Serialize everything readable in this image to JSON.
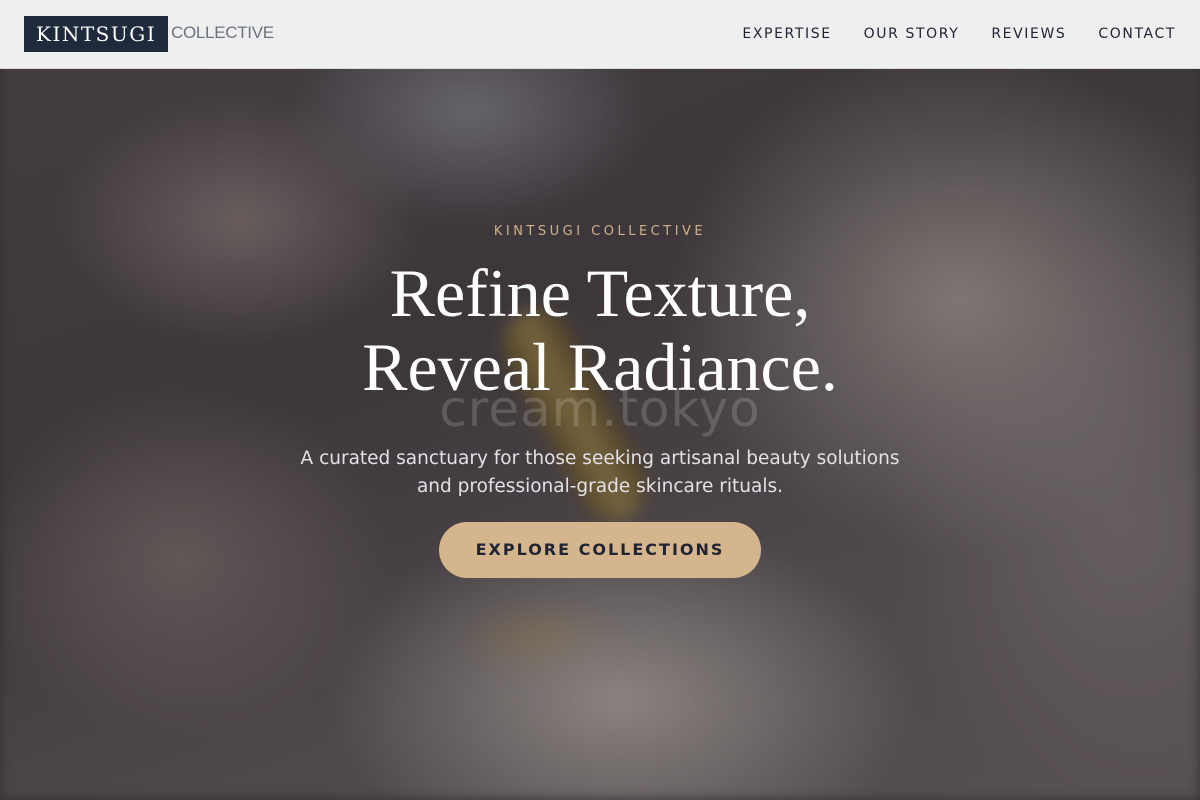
{
  "header": {
    "logo_main": "KINTSUGI",
    "logo_sub": "COLLECTIVE",
    "nav": [
      {
        "label": "EXPERTISE"
      },
      {
        "label": "OUR STORY"
      },
      {
        "label": "REVIEWS"
      },
      {
        "label": "CONTACT"
      }
    ]
  },
  "hero": {
    "eyebrow": "KINTSUGI COLLECTIVE",
    "headline_line1": "Refine Texture,",
    "headline_line2": "Reveal Radiance.",
    "subhead_line1": "A curated sanctuary for those seeking artisanal beauty solutions",
    "subhead_line2": "and professional-grade skincare rituals.",
    "cta_label": "EXPLORE COLLECTIONS",
    "watermark": "cream.tokyo"
  },
  "colors": {
    "brand_navy": "#1f2a3d",
    "accent_gold": "#d4b58e",
    "eyebrow_gold": "#cfb18a"
  }
}
